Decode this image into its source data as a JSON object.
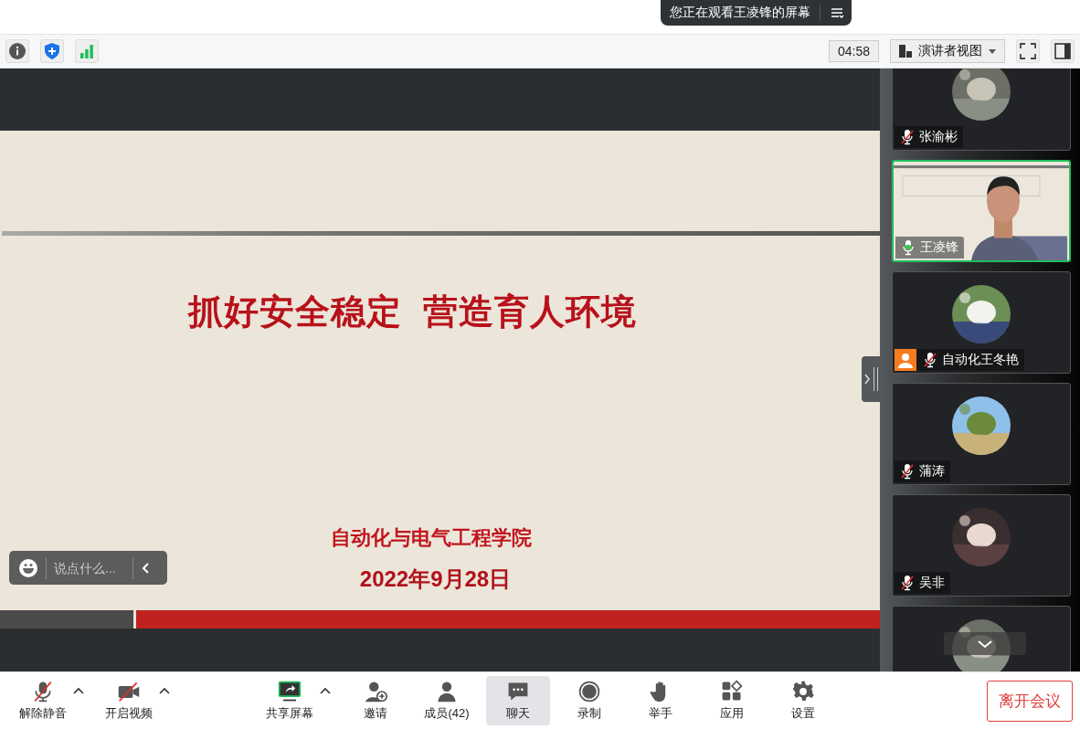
{
  "banner": {
    "text": "您正在观看王凌锋的屏幕"
  },
  "top_toolbar": {
    "timer": "04:58",
    "view_menu": "演讲者视图"
  },
  "slide": {
    "title": "抓好安全稳定  营造育人环境",
    "org": "自动化与电气工程学院",
    "date": "2022年9月28日"
  },
  "chat_bubble": {
    "placeholder": "说点什么..."
  },
  "participants": [
    {
      "kind": "avatar",
      "name": "张渝彬",
      "muted": true,
      "speaking": false,
      "role_badge": false
    },
    {
      "kind": "video",
      "name": "王凌锋",
      "muted": false,
      "speaking": true,
      "role_badge": false
    },
    {
      "kind": "avatar",
      "name": "自动化王冬艳",
      "muted": true,
      "speaking": false,
      "role_badge": true
    },
    {
      "kind": "avatar",
      "name": "蒲涛",
      "muted": true,
      "speaking": false,
      "role_badge": false
    },
    {
      "kind": "avatar",
      "name": "吴非",
      "muted": true,
      "speaking": false,
      "role_badge": false
    },
    {
      "kind": "avatar",
      "speaking": false
    }
  ],
  "toolbar": {
    "items": [
      {
        "kind": "mic",
        "label": "解除静音",
        "off": true,
        "has_menu": true,
        "selected": false
      },
      {
        "kind": "video",
        "label": "开启视频",
        "off": true,
        "has_menu": true,
        "selected": false
      },
      {
        "kind": "share",
        "label": "共享屏幕",
        "has_menu": true,
        "selected": false
      },
      {
        "kind": "invite",
        "label": "邀请",
        "has_menu": false,
        "selected": false
      },
      {
        "kind": "members",
        "label": "成员(42)",
        "has_menu": false,
        "selected": false
      },
      {
        "kind": "chat",
        "label": "聊天",
        "has_menu": false,
        "selected": true
      },
      {
        "kind": "record",
        "label": "录制",
        "has_menu": false,
        "selected": false
      },
      {
        "kind": "hand",
        "label": "举手",
        "has_menu": false,
        "selected": false
      },
      {
        "kind": "apps",
        "label": "应用",
        "has_menu": false,
        "selected": false
      },
      {
        "kind": "settings",
        "label": "设置",
        "has_menu": false,
        "selected": false
      }
    ],
    "leave": "离开会议"
  }
}
